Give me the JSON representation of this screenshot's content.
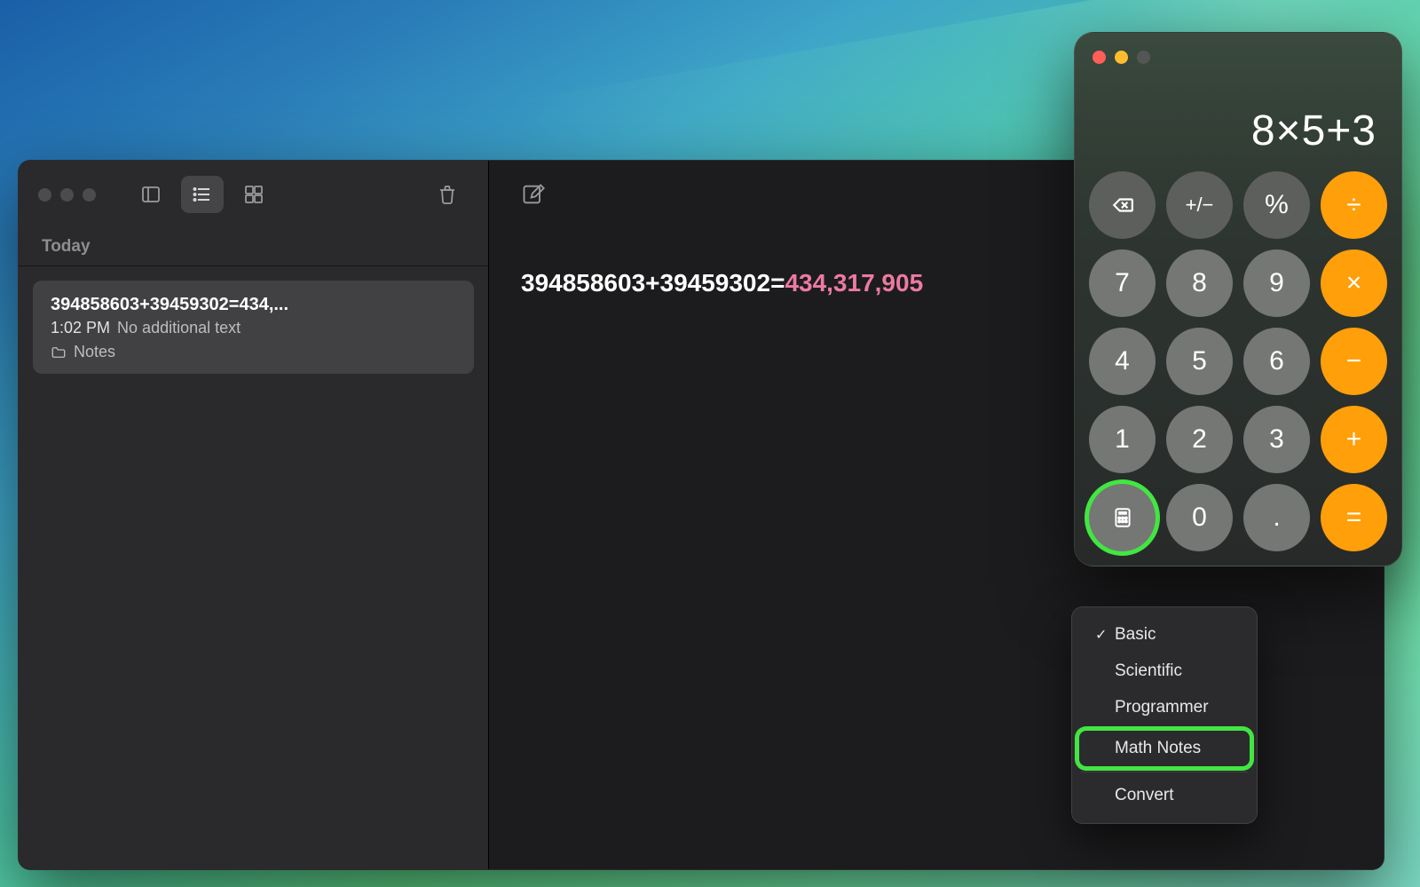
{
  "notes": {
    "section_header": "Today",
    "card": {
      "title": "394858603+39459302=434,...",
      "time": "1:02 PM",
      "sub": "No additional text",
      "folder": "Notes"
    },
    "editor": {
      "expr": "394858603+39459302=",
      "result": "434,317,905"
    }
  },
  "calc": {
    "display": "8×5+3",
    "keys": {
      "bksp": "⌫",
      "pm": "+/−",
      "pct": "%",
      "div": "÷",
      "k7": "7",
      "k8": "8",
      "k9": "9",
      "mul": "×",
      "k4": "4",
      "k5": "5",
      "k6": "6",
      "sub": "−",
      "k1": "1",
      "k2": "2",
      "k3": "3",
      "add": "+",
      "mode": "",
      "k0": "0",
      "dot": ".",
      "eq": "="
    },
    "menu": {
      "basic": "Basic",
      "scientific": "Scientific",
      "programmer": "Programmer",
      "math_notes": "Math Notes",
      "convert": "Convert",
      "checked": "basic",
      "highlighted": "math_notes"
    }
  }
}
